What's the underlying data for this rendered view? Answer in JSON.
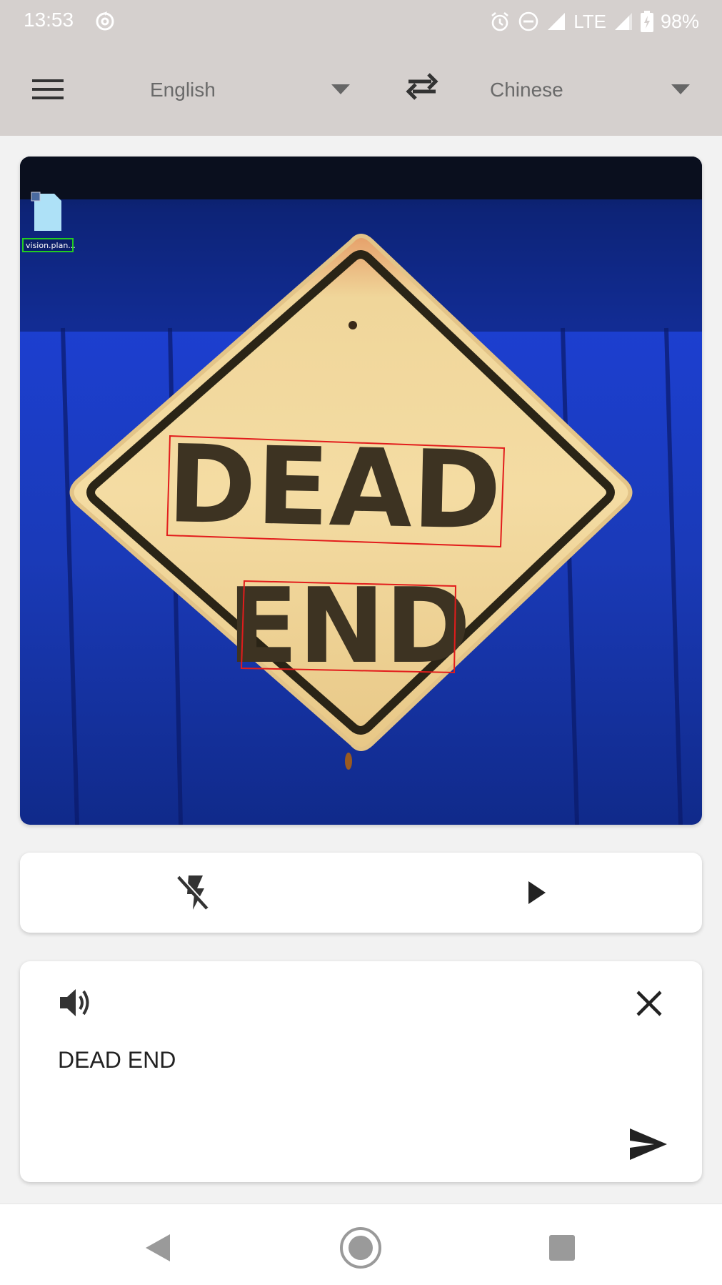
{
  "status_bar": {
    "time": "13:53",
    "network": "LTE",
    "battery": "98%",
    "icons": [
      "hotspot-icon",
      "alarm-icon",
      "do-not-disturb-icon",
      "signal-icon",
      "signal-icon",
      "battery-charging-icon"
    ]
  },
  "app_bar": {
    "source_language": "English",
    "target_language": "Chinese",
    "icons": [
      "menu-icon",
      "dropdown-caret-icon",
      "swap-icon"
    ]
  },
  "camera_image": {
    "file_label": "vision.plan...",
    "sign_lines": [
      "DEAD",
      "END"
    ],
    "detection_box_color": "#e21c1c",
    "file_label_box_color": "#22cc22"
  },
  "controls": {
    "icons": [
      "flash-off-icon",
      "play-icon"
    ]
  },
  "result": {
    "text": "DEAD END",
    "icons": [
      "speaker-icon",
      "close-icon",
      "send-icon"
    ]
  },
  "nav_bar": {
    "icons": [
      "back-icon",
      "home-icon",
      "recents-icon"
    ]
  }
}
